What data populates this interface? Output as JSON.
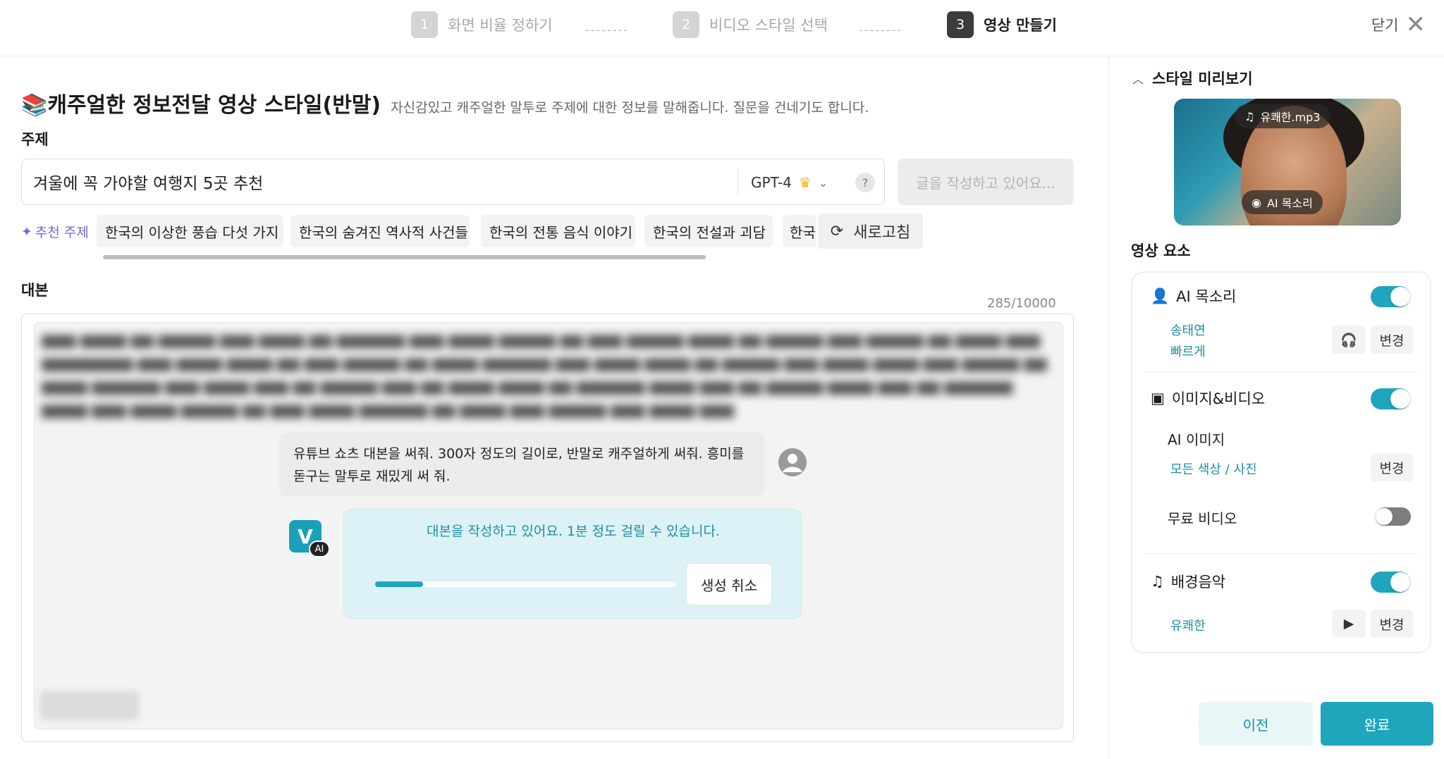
{
  "colors": {
    "accent": "#1fa6bd",
    "accent_text": "#1f8ea3",
    "accent_bg": "#dcf2f6",
    "recommend": "#6b6bd8"
  },
  "stepper": {
    "steps": [
      {
        "num": "1",
        "label": "화면 비율 정하기",
        "state": "inactive"
      },
      {
        "num": "2",
        "label": "비디오 스타일 선택",
        "state": "inactive"
      },
      {
        "num": "3",
        "label": "영상 만들기",
        "state": "active"
      }
    ],
    "separator": "--------",
    "close_label": "닫기",
    "close_icon": "close-icon"
  },
  "style": {
    "emoji": "📚",
    "name": "캐주얼한 정보전달 영상 스타일(반말)",
    "description": "자신감있고 캐주얼한 말투로 주제에 대한 정보를 말해줍니다. 질문을 건네기도 합니다."
  },
  "topic": {
    "label": "주제",
    "value": "겨울에 꼭 가야할 여행지 5곳 추천",
    "model": "GPT-4",
    "help": "?",
    "write_button": "글을 작성하고 있어요..."
  },
  "recommend": {
    "label": "추천 주제",
    "chips": [
      "한국의 이상한 풍습 다섯 가지",
      "한국의 숨겨진 역사적 사건들",
      "한국의 전통 음식 이야기",
      "한국의 전설과 괴담",
      "한국"
    ],
    "refresh_label": "새로고침"
  },
  "script": {
    "label": "대본",
    "counter": "285/10000",
    "user_prompt": "유튜브 쇼츠 대본을 써줘. 300자 정도의 길이로, 반말로 캐주얼하게 써줘. 흥미를 돋구는 말투로 재밌게 써 줘.",
    "ai_badge": "AI",
    "ai_logo": "V",
    "ai_status": "대본을 작성하고 있어요. 1분 정도 걸릴 수 있습니다.",
    "progress": 0.16,
    "cancel_label": "생성 취소"
  },
  "preview": {
    "title": "스타일 미리보기",
    "music_pill": "유쾌한.mp3",
    "voice_pill": "AI 목소리"
  },
  "elements": {
    "title": "영상 요소",
    "voice": {
      "label": "AI 목소리",
      "enabled": true,
      "voice_name": "송태연",
      "speed": "빠르게",
      "change_label": "변경"
    },
    "image_video": {
      "label": "이미지&비디오",
      "enabled": true,
      "ai_image_label": "AI 이미지",
      "ai_image_value": "모든 색상 / 사진",
      "change_label": "변경",
      "free_video_label": "무료 비디오",
      "free_video_enabled": false
    },
    "music": {
      "label": "배경음악",
      "enabled": true,
      "value": "유쾌한",
      "change_label": "변경"
    }
  },
  "footer": {
    "prev_label": "이전",
    "done_label": "완료"
  }
}
